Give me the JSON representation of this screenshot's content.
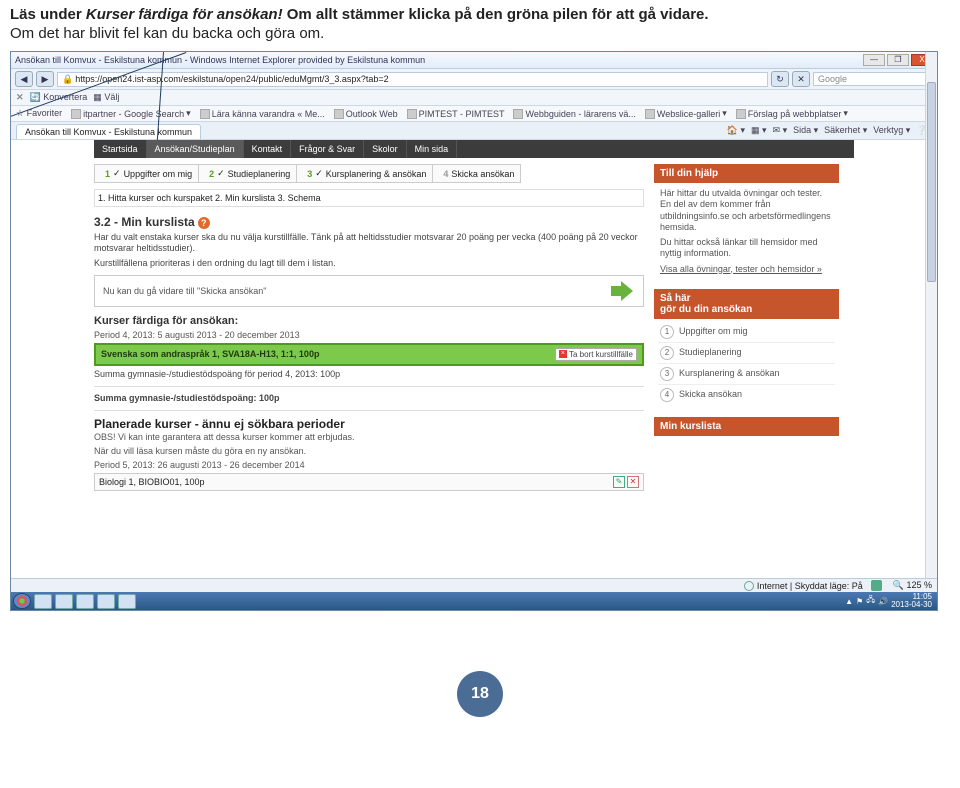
{
  "instruction": {
    "part1": "Läs under ",
    "italic": "Kurser färdiga för ansökan!",
    "part2": " Om allt stämmer klicka på den gröna pilen för att gå vidare.",
    "line2": "Om det har blivit fel kan du backa och göra om."
  },
  "window": {
    "title": "Ansökan till Komvux - Eskilstuna kommun - Windows Internet Explorer provided by Eskilstuna kommun",
    "url": "https://open24.ist-asp.com/eskilstuna/open24/public/eduMgmt/3_3.aspx?tab=2",
    "search_placeholder": "Google",
    "konvertera": "Konvertera",
    "valj": "Välj",
    "favoriter_label": "Favoriter",
    "fav_items": [
      "itpartner - Google Search",
      "Lära känna varandra « Me...",
      "Outlook Web",
      "PIMTEST - PIMTEST",
      "Webbguiden - lärarens vä...",
      "Webslice-galleri",
      "Förslag på webbplatser"
    ],
    "tab_title": "Ansökan till Komvux - Eskilstuna kommun",
    "tab_tools": [
      "Sida",
      "Säkerhet",
      "Verktyg"
    ]
  },
  "nav": {
    "items": [
      "Startsida",
      "Ansökan/Studieplan",
      "Kontakt",
      "Frågor & Svar",
      "Skolor",
      "Min sida"
    ]
  },
  "steps": [
    {
      "num": "1",
      "label": "Uppgifter om mig"
    },
    {
      "num": "2",
      "label": "Studieplanering"
    },
    {
      "num": "3",
      "label": "Kursplanering & ansökan"
    },
    {
      "num": "4",
      "label": "Skicka ansökan"
    }
  ],
  "substeps_text": "1. Hitta kurser och kurspaket   2. Min kurslista   3. Schema",
  "section_title": "3.2 - Min kurslista",
  "body1": "Har du valt enstaka kurser ska du nu välja kurstillfälle. Tänk på att heltidsstudier motsvarar 20 poäng per vecka (400 poäng på 20 veckor motsvarar heltidsstudier).",
  "body2": "Kurstillfällena prioriteras i den ordning du lagt till dem i listan.",
  "goahead": "Nu kan du gå vidare till \"Skicka ansökan\"",
  "ready_head": "Kurser färdiga för ansökan:",
  "period4": "Period 4, 2013: 5 augusti 2013 - 20 december 2013",
  "green_course": "Svenska som andraspråk 1, SVA18A-H13, 1:1, 100p",
  "remove_label": "Ta bort kurstillfälle",
  "summa_p4": "Summa gymnasie-/studiestödspoäng för period 4, 2013: 100p",
  "summa_total": "Summa gymnasie-/studiestödspoäng: 100p",
  "planned_head": "Planerade kurser - ännu ej sökbara perioder",
  "obs": "OBS! Vi kan inte garantera att dessa kurser kommer att erbjudas.",
  "obs2": "När du vill läsa kursen måste du göra en ny ansökan.",
  "period5": "Period 5, 2013: 26 augusti 2013 - 26 december 2014",
  "planned_course": "Biologi 1, BIOBIO01, 100p",
  "rhelp": {
    "head": "Till din hjälp",
    "p1": "Här hittar du utvalda övningar och tester. En del av dem kommer från utbildningsinfo.se och arbetsförmedlingens hemsida.",
    "p2": "Du hittar också länkar till hemsidor med nyttig information.",
    "link": "Visa alla övningar, tester och hemsidor »"
  },
  "rsteps_head": "Så här\ngör du din ansökan",
  "rsteps": [
    "Uppgifter om mig",
    "Studieplanering",
    "Kursplanering & ansökan",
    "Skicka ansökan"
  ],
  "rlist_head": "Min kurslista",
  "status": {
    "text": "Internet | Skyddat läge: På",
    "zoom": "125 %"
  },
  "clock": {
    "time": "11:05",
    "date": "2013-04-30"
  },
  "page_number": "18"
}
